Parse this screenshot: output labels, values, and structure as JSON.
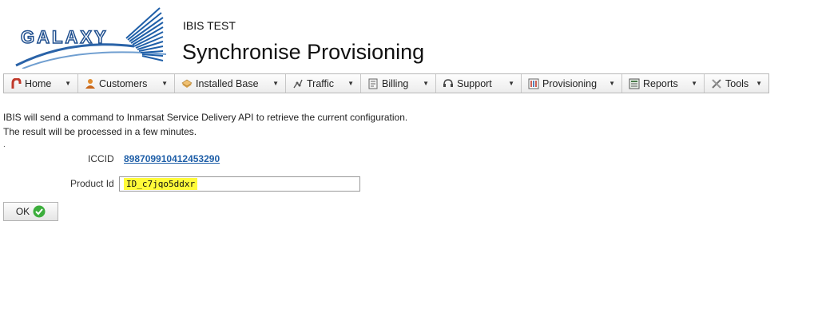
{
  "branding": {
    "logo_text": "GALAXY",
    "app_name": "IBIS TEST",
    "page_title": "Synchronise Provisioning"
  },
  "menu": {
    "items": [
      {
        "label": "Home",
        "icon": "home-icon"
      },
      {
        "label": "Customers",
        "icon": "customers-icon"
      },
      {
        "label": "Installed Base",
        "icon": "installed-base-icon"
      },
      {
        "label": "Traffic",
        "icon": "traffic-icon"
      },
      {
        "label": "Billing",
        "icon": "billing-icon"
      },
      {
        "label": "Support",
        "icon": "headset-icon"
      },
      {
        "label": "Provisioning",
        "icon": "provisioning-icon"
      },
      {
        "label": "Reports",
        "icon": "reports-icon"
      },
      {
        "label": "Tools",
        "icon": "tools-icon"
      }
    ]
  },
  "content": {
    "info_line1": "IBIS will send a command to Inmarsat Service Delivery API to retrieve the current configuration.",
    "info_line2": "The result will be processed in a few minutes.",
    "dot": ".",
    "iccid_label": "ICCID",
    "iccid_value": "898709910412453290",
    "product_id_label": "Product Id",
    "product_id_value": "ID_c7jqo5ddxr",
    "ok_label": "OK"
  },
  "colors": {
    "link": "#1f5fa8",
    "highlight": "#fffb3a",
    "ok_check": "#3cae3c",
    "logo_blue": "#1f4f8f"
  }
}
